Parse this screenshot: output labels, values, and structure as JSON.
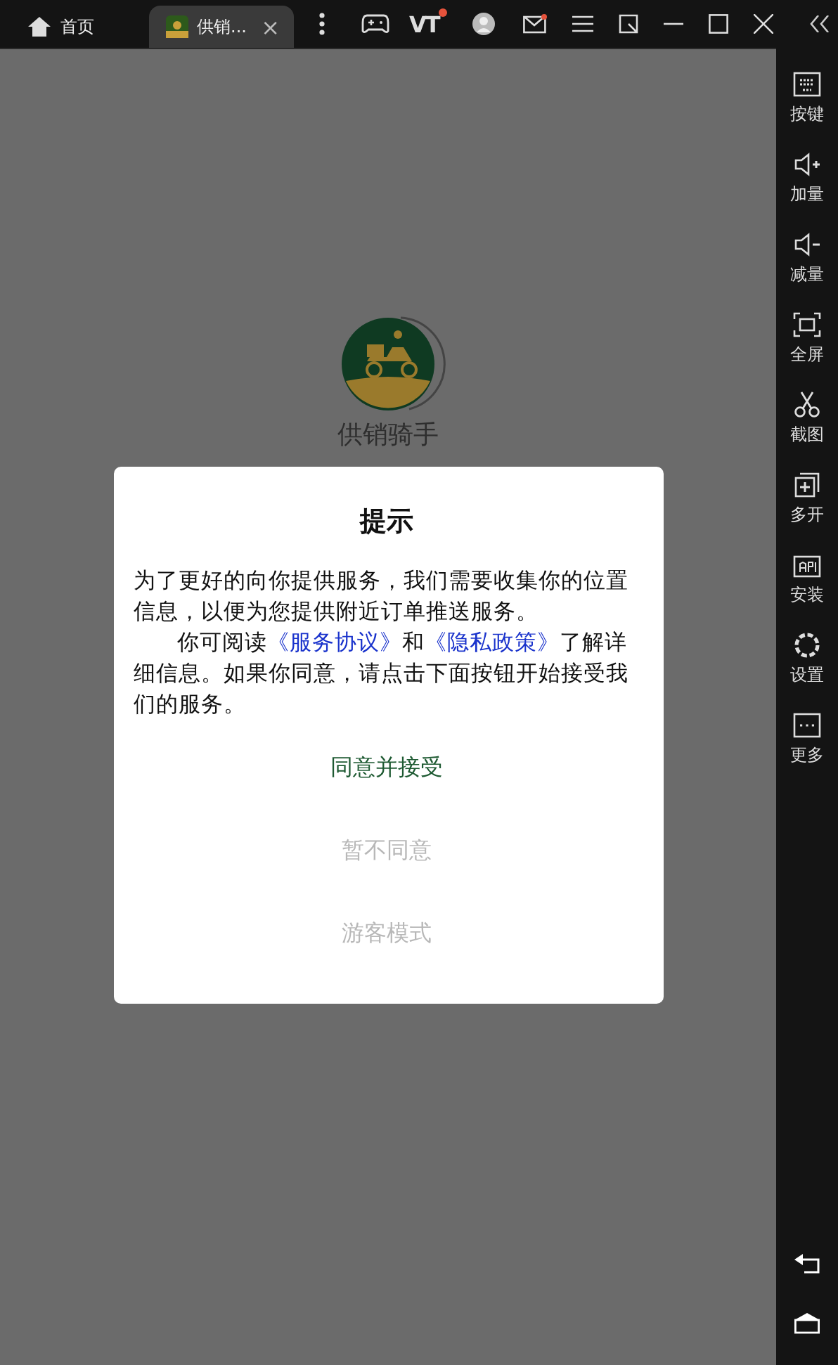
{
  "titlebar": {
    "tabs": [
      {
        "label": "首页",
        "selected": false
      },
      {
        "label": "供销...",
        "selected": true,
        "close": "×"
      }
    ],
    "vt_badge": "VT"
  },
  "app": {
    "name": "供销骑手"
  },
  "dialog": {
    "title": "提示",
    "intro": "为了更好的向你提供服务，我们需要收集你的位置信息，以便为您提供附近订单推送服务。",
    "read_prefix": "你可阅读",
    "link_1": "《服务协议》",
    "joiner": "和",
    "link_2": "《隐私政策》",
    "read_suffix": "了解详细信息。如果你同意，请点击下面按钮开始接受我们的服务。",
    "buttons": [
      {
        "label": "同意并接受",
        "kind": "primary"
      },
      {
        "label": "暂不同意",
        "kind": "secondary"
      },
      {
        "label": "游客模式",
        "kind": "secondary"
      }
    ]
  },
  "sidebar": {
    "items": [
      {
        "label": "按键"
      },
      {
        "label": "加量"
      },
      {
        "label": "减量"
      },
      {
        "label": "全屏"
      },
      {
        "label": "截图"
      },
      {
        "label": "多开"
      },
      {
        "label": "安装"
      },
      {
        "label": "设置"
      },
      {
        "label": "更多"
      }
    ]
  }
}
